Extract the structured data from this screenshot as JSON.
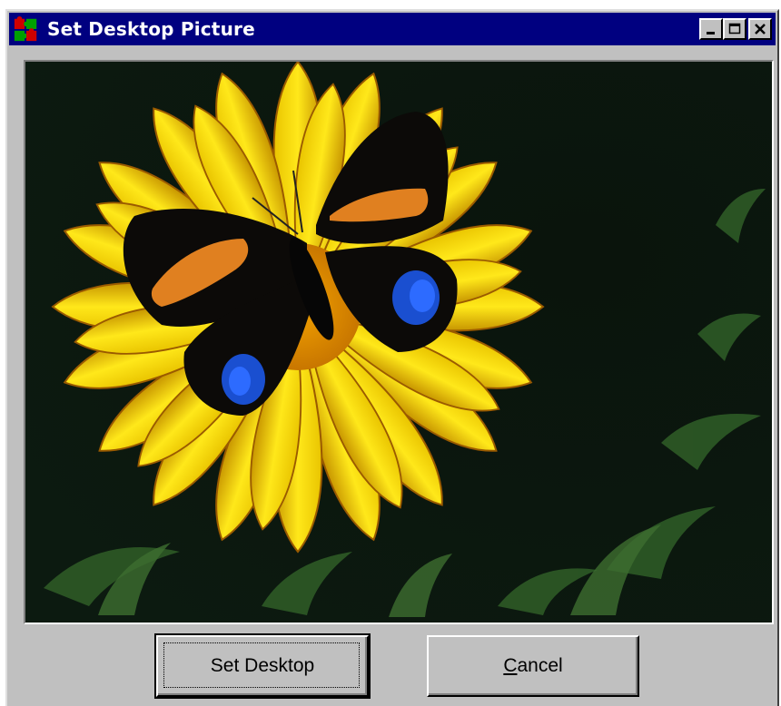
{
  "window": {
    "title": "Set Desktop Picture",
    "icon": "puzzle-piece-icon",
    "controls": {
      "minimize": "minimize-icon",
      "maximize": "maximize-icon",
      "close": "close-icon"
    }
  },
  "preview": {
    "subject": "butterfly-on-yellow-flower-image"
  },
  "buttons": {
    "set_desktop": "Set Desktop",
    "cancel_prefix": "C",
    "cancel_rest": "ancel"
  },
  "colors": {
    "titlebar": "#000080",
    "face": "#c0c0c0"
  }
}
